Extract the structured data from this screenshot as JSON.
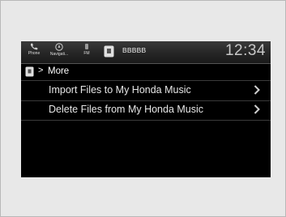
{
  "status_bar": {
    "phone_label": "Phone",
    "nav_label": "Navigati...",
    "fm_label": "FM",
    "source_name": "BBBBB",
    "clock": "12:34",
    "icons": {
      "phone": "phone-icon",
      "navigation": "navigation-icon",
      "fm": "fm-radio-icon",
      "usb": "usb-device-icon"
    }
  },
  "header": {
    "separator": ">",
    "breadcrumb": "More"
  },
  "menu": {
    "items": [
      {
        "label": "Import Files to My Honda Music"
      },
      {
        "label": "Delete Files from My Honda Music"
      }
    ]
  },
  "colors": {
    "screen_background": "#000000",
    "text": "#e6e6e6",
    "clock": "#c8c8c8",
    "page_background": "#e8e8e8"
  }
}
